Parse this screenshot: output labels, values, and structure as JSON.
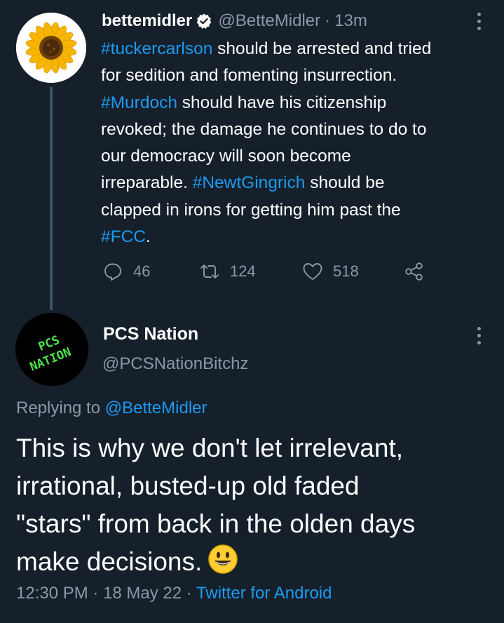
{
  "parent_tweet": {
    "display_name": "bettemidler",
    "handle": "@BetteMidler",
    "separator": "·",
    "time": "13m",
    "text_lines": [
      [
        {
          "t": "#tuckercarlson",
          "tag": true
        },
        {
          "t": " should be arrested and tried",
          "tag": false
        }
      ],
      [
        {
          "t": "for sedition and fomenting insurrection.",
          "tag": false
        }
      ],
      [
        {
          "t": "#Murdoch",
          "tag": true
        },
        {
          "t": " should have his citizenship",
          "tag": false
        }
      ],
      [
        {
          "t": "revoked; the damage he continues to do to",
          "tag": false
        }
      ],
      [
        {
          "t": "our democracy will soon become",
          "tag": false
        }
      ],
      [
        {
          "t": "irreparable. ",
          "tag": false
        },
        {
          "t": "#NewtGingrich",
          "tag": true
        },
        {
          "t": " should be",
          "tag": false
        }
      ],
      [
        {
          "t": "clapped in irons for getting him past the",
          "tag": false
        }
      ],
      [
        {
          "t": "#FCC",
          "tag": true
        },
        {
          "t": ".",
          "tag": false
        }
      ]
    ],
    "actions": {
      "replies": "46",
      "retweets": "124",
      "likes": "518"
    }
  },
  "reply_tweet": {
    "display_name": "PCS Nation",
    "handle": "@PCSNationBitchz",
    "avatar_text_line1": "PCS",
    "avatar_text_line2": "NATION",
    "replying_prefix": "Replying to ",
    "replying_to": "@BetteMidler",
    "text_lines": [
      "This is why we don't let irrelevant,",
      "irrational, busted-up old faded",
      "\"stars\" from back in the olden days",
      "make decisions."
    ],
    "emoji": "smiling-face",
    "time": "12:30 PM",
    "sep1": " · ",
    "date": "18 May 22",
    "sep2": " · ",
    "source": "Twitter for Android"
  },
  "colors": {
    "background": "#15202b",
    "link": "#1d9bf0",
    "secondary_text": "#8b98a5",
    "avatar_text": "#4ee34a"
  }
}
